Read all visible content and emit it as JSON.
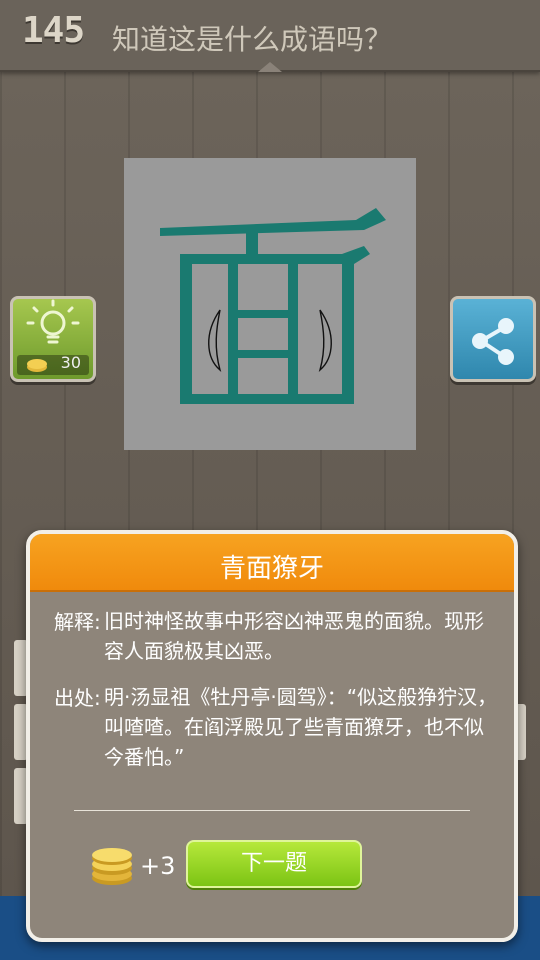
{
  "header": {
    "level_number": "145",
    "question": "知道这是什么成语吗？"
  },
  "puzzle": {
    "character": "面",
    "character_color": "#1a7a70",
    "background_color": "#9a9a9a"
  },
  "hint_button": {
    "icon": "lightbulb-icon",
    "cost": "30"
  },
  "share_button": {
    "icon": "share-icon"
  },
  "dialog": {
    "title": "青面獠牙",
    "explanation_label": "解释:",
    "explanation_text": "旧时神怪故事中形容凶神恶鬼的面貌。现形容人面貌极其凶恶。",
    "source_label": "出处:",
    "source_text": "明·汤显祖《牡丹亭·圆驾》：“似这般狰狞汉，叫喳喳。在阎浮殿见了些青面獠牙，也不似今番怕。”",
    "reward": "+3",
    "next_button": "下一题"
  },
  "colors": {
    "header_orange": "#f7a321",
    "next_green": "#8fd21f",
    "banner_blue": "#1a4e86"
  }
}
